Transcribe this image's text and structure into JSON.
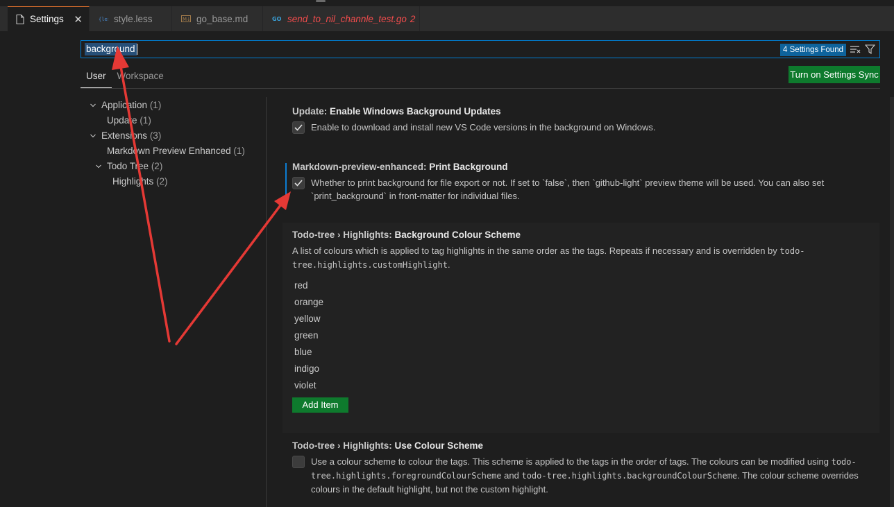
{
  "tabs": [
    {
      "label": "Settings",
      "icon": "file-icon",
      "active": true
    },
    {
      "label": "style.less",
      "icon": "less-file-icon"
    },
    {
      "label": "go_base.md",
      "icon": "markdown-file-icon"
    },
    {
      "label": "send_to_nil_channle_test.go",
      "icon": "go-file-icon",
      "problems": "2"
    }
  ],
  "search": {
    "value": "background",
    "results_badge": "4 Settings Found"
  },
  "scopes": {
    "user": "User",
    "workspace": "Workspace"
  },
  "sync_button": "Turn on Settings Sync",
  "toc": [
    {
      "label": "Application",
      "count": "(1)"
    },
    {
      "label": "Update",
      "count": "(1)"
    },
    {
      "label": "Extensions",
      "count": "(3)"
    },
    {
      "label": "Markdown Preview Enhanced",
      "count": "(1)"
    },
    {
      "label": "Todo Tree",
      "count": "(2)"
    },
    {
      "label": "Highlights",
      "count": "(2)"
    }
  ],
  "settings": {
    "update_bg": {
      "category": "Update: ",
      "name": "Enable Windows Background Updates",
      "desc": "Enable to download and install new VS Code versions in the background on Windows.",
      "checked": true
    },
    "print_bg": {
      "category": "Markdown-preview-enhanced: ",
      "name": "Print Background",
      "desc": "Whether to print background for file export or not. If set to `false`, then `github-light` preview theme will be used. You can also set `print_background` in front-matter for individual files.",
      "checked": true
    },
    "colour_scheme": {
      "category": "Todo-tree › Highlights: ",
      "name": "Background Colour Scheme",
      "desc_text": "A list of colours which is applied to tag highlights in the same order as the tags. Repeats if necessary and is overridden by ",
      "desc_code": "todo-tree.highlights.customHighlight",
      "desc_end": ".",
      "items": [
        "red",
        "orange",
        "yellow",
        "green",
        "blue",
        "indigo",
        "violet"
      ],
      "add_label": "Add Item"
    },
    "use_scheme": {
      "category": "Todo-tree › Highlights: ",
      "name": "Use Colour Scheme",
      "desc_1": "Use a colour scheme to colour the tags. This scheme is applied to the tags in the order of tags. The colours can be modified using ",
      "code_1": "todo-tree.highlights.foregroundColourScheme",
      "desc_2": " and ",
      "code_2": "todo-tree.highlights.backgroundColourScheme",
      "desc_3": ". The colour scheme overrides colours in the default highlight, but not the custom highlight.",
      "checked": false
    }
  },
  "colors": {
    "accent": "#007fd4",
    "button": "#0e7a2d",
    "annotation_arrow": "#e53935",
    "error": "#f14c4c"
  }
}
